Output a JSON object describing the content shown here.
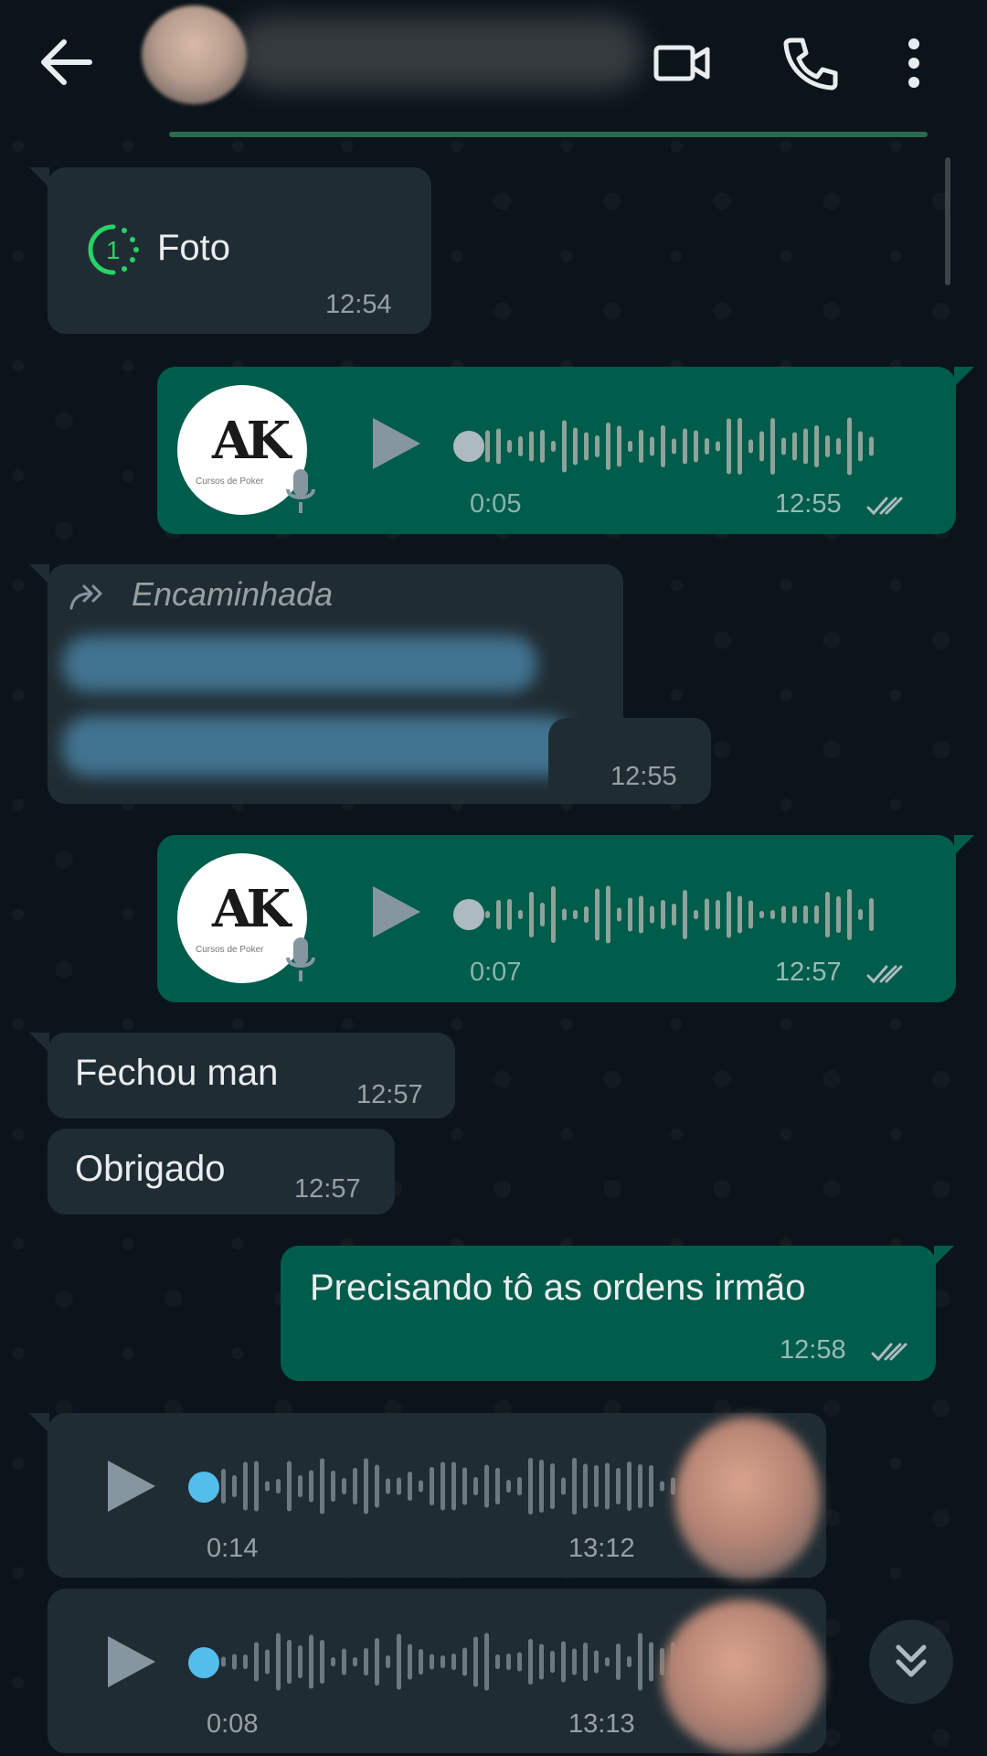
{
  "header": {
    "back_icon": "arrow-left-icon",
    "video_icon": "video-call-icon",
    "phone_icon": "phone-icon",
    "menu_icon": "more-vertical-icon"
  },
  "colors": {
    "background": "#0b141a",
    "incoming_bubble": "#202c33",
    "outgoing_bubble": "#005c4b",
    "accent_green": "#25d366",
    "unplayed_blue": "#53bdeb"
  },
  "messages": {
    "m1": {
      "label": "Foto",
      "view_once_icon": "view-once-icon",
      "view_once_count": "1",
      "time": "12:54"
    },
    "m2": {
      "type": "voice",
      "duration": "0:05",
      "time": "12:55",
      "avatar_logo": "AK",
      "avatar_caption": "Cursos de Poker"
    },
    "m3": {
      "forwarded_label": "Encaminhada",
      "time": "12:55"
    },
    "m4": {
      "type": "voice",
      "duration": "0:07",
      "time": "12:57",
      "avatar_logo": "AK",
      "avatar_caption": "Cursos de Poker"
    },
    "m5": {
      "text": "Fechou man",
      "time": "12:57"
    },
    "m6": {
      "text": "Obrigado",
      "time": "12:57"
    },
    "m7": {
      "text": "Precisando tô as ordens irmão",
      "time": "12:58"
    },
    "m8": {
      "type": "voice",
      "duration": "0:14",
      "time": "13:12"
    },
    "m9": {
      "type": "voice",
      "duration": "0:08",
      "time": "13:13"
    }
  },
  "scroll_down_icon": "double-chevron-down-icon"
}
